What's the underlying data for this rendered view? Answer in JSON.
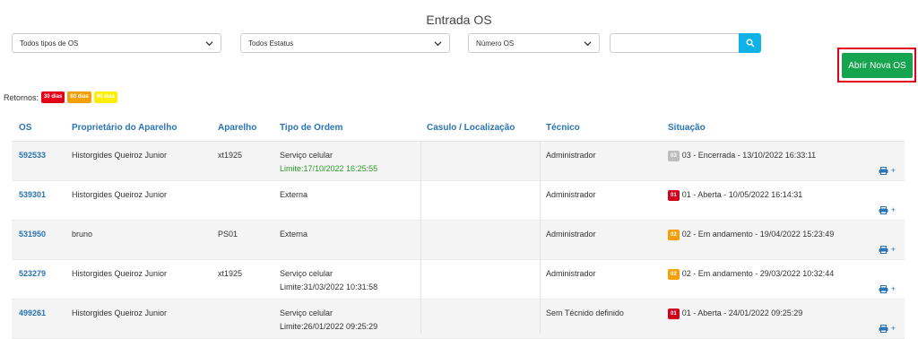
{
  "page": {
    "title": "Entrada OS"
  },
  "filters": {
    "tipo": "Todos tipos de OS",
    "status": "Todos Estatus",
    "numero": "Número OS",
    "search_value": ""
  },
  "actions": {
    "new_os": "Abrir Nova OS"
  },
  "retornos": {
    "label": "Retornos:",
    "badges": [
      {
        "text": "30 dias",
        "color": "#e3001b"
      },
      {
        "text": "60 dias",
        "color": "#f5a00a"
      },
      {
        "text": "90 dias",
        "color": "#ffee00"
      }
    ]
  },
  "table": {
    "headers": [
      "OS",
      "Proprietário do Aparelho",
      "Aparelho",
      "Tipo de Ordem",
      "Casulo / Localização",
      "Técnico",
      "Situação"
    ],
    "rows": [
      {
        "os": "592533",
        "owner": "Historgides Queiroz Junior",
        "device": "xt1925",
        "type": "Serviço celular",
        "limit": "Limite:17/10/2022 16:25:55",
        "casulo": "",
        "tech": "Administrador",
        "code": "03",
        "status": "03 - Encerrada - 13/10/2022 16:33:11"
      },
      {
        "os": "539301",
        "owner": "Historgides Queiroz Junior",
        "device": "",
        "type": "Externa",
        "limit": "",
        "casulo": "",
        "tech": "Administrador",
        "code": "01",
        "status": "01 - Aberta - 10/05/2022 16:14:31"
      },
      {
        "os": "531950",
        "owner": "bruno",
        "device": "PS01",
        "type": "Externa",
        "limit": "",
        "casulo": "",
        "tech": "Administrador",
        "code": "02",
        "status": "02 - Em andamento - 19/04/2022 15:23:49"
      },
      {
        "os": "523279",
        "owner": "Historgides Queiroz Junior",
        "device": "xt1925",
        "type": "Serviço celular",
        "limit": "Limite:31/03/2022 10:31:58",
        "casulo": "",
        "tech": "Administrador",
        "code": "02",
        "status": "02 - Em andamento - 29/03/2022 10:32:44"
      },
      {
        "os": "499261",
        "owner": "Historgides Queiroz Junior",
        "device": "",
        "type": "Serviço celular",
        "limit": "Limite:26/01/2022 09:25:29",
        "casulo": "",
        "tech": "Sem Técnido definido",
        "code": "01",
        "status": "01 - Aberta - 24/01/2022 09:25:29"
      }
    ],
    "plus_label": "+"
  },
  "colors": {
    "link": "#2a74b4",
    "limit_green": "#2a9a2a",
    "code_03": "#bdbdbd",
    "code_01": "#d0021b",
    "code_02": "#f5a00a"
  }
}
